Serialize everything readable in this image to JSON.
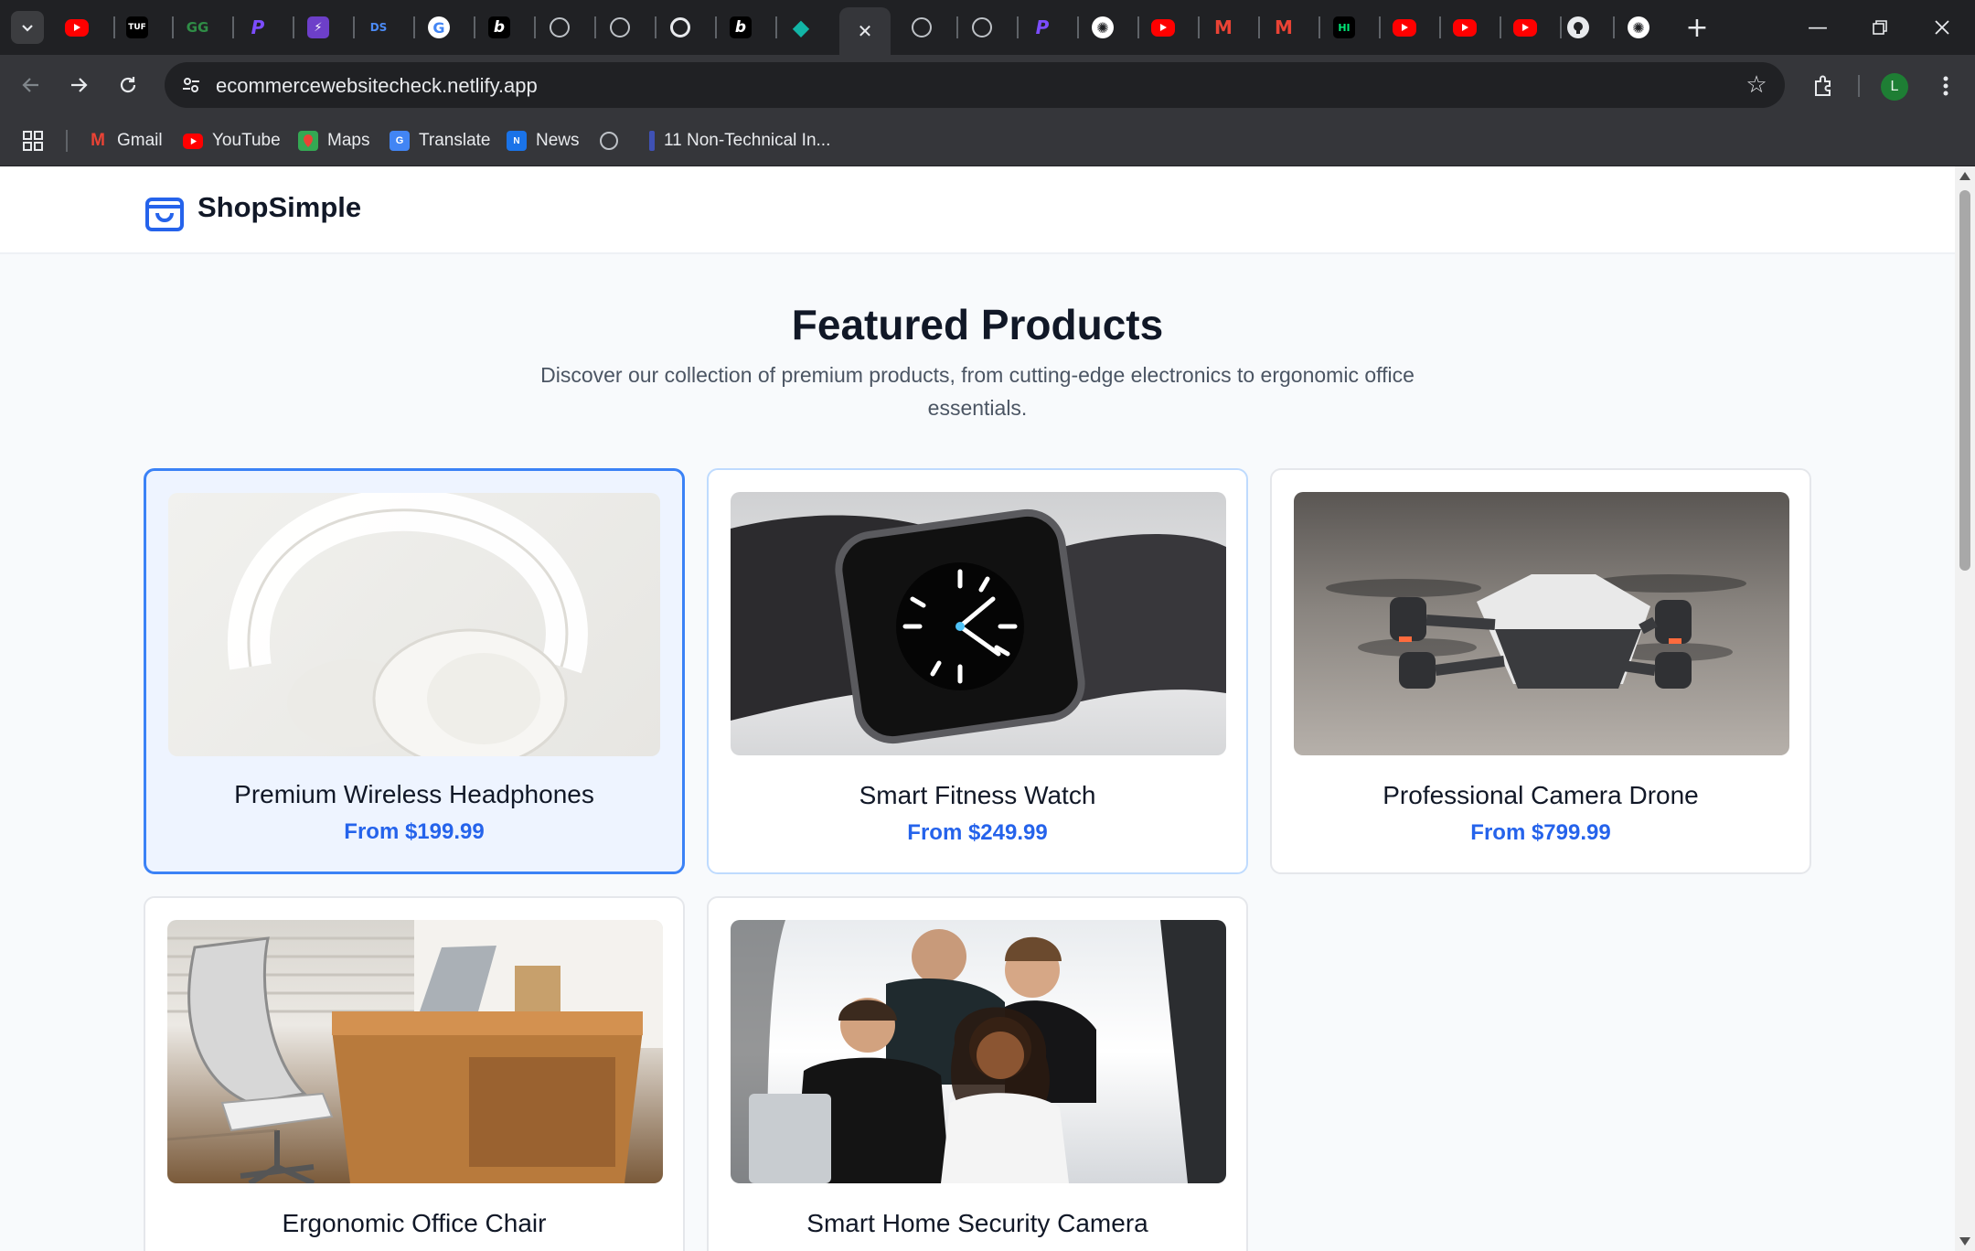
{
  "browser": {
    "url": "ecommercewebsitecheck.netlify.app",
    "profile_initial": "L",
    "tabs": [
      {
        "icon": "youtube-icon",
        "glyph": ""
      },
      {
        "icon": "tuf-icon",
        "glyph": "TUF"
      },
      {
        "icon": "geeksforgeeks-icon",
        "glyph": "GG"
      },
      {
        "icon": "p-logo-icon",
        "glyph": "P"
      },
      {
        "icon": "bolt-icon",
        "glyph": "⚡"
      },
      {
        "icon": "ds-icon",
        "glyph": "DS"
      },
      {
        "icon": "google-icon",
        "glyph": "G"
      },
      {
        "icon": "b-logo-icon",
        "glyph": "b"
      },
      {
        "icon": "globe-icon",
        "glyph": ""
      },
      {
        "icon": "globe-icon",
        "glyph": ""
      },
      {
        "icon": "chrome-icon",
        "glyph": ""
      },
      {
        "icon": "b-logo-icon",
        "glyph": "b"
      },
      {
        "icon": "diamond-icon",
        "glyph": "◆"
      },
      {
        "icon": "close-icon",
        "glyph": "✕"
      },
      {
        "icon": "globe-icon",
        "glyph": ""
      },
      {
        "icon": "globe-icon",
        "glyph": ""
      },
      {
        "icon": "p-logo-icon",
        "glyph": "P"
      },
      {
        "icon": "openai-icon",
        "glyph": "✺"
      },
      {
        "icon": "youtube-icon",
        "glyph": ""
      },
      {
        "icon": "gmail-icon",
        "glyph": "M"
      },
      {
        "icon": "gmail-icon",
        "glyph": "M"
      },
      {
        "icon": "hi-icon",
        "glyph": "HI"
      },
      {
        "icon": "youtube-icon",
        "glyph": ""
      },
      {
        "icon": "youtube-icon",
        "glyph": ""
      },
      {
        "icon": "youtube-icon",
        "glyph": ""
      },
      {
        "icon": "github-icon",
        "glyph": ""
      },
      {
        "icon": "openai-icon",
        "glyph": "✺"
      }
    ],
    "bookmarks": [
      {
        "label": "Gmail",
        "icon": "gmail-icon"
      },
      {
        "label": "YouTube",
        "icon": "youtube-icon"
      },
      {
        "label": "Maps",
        "icon": "maps-icon"
      },
      {
        "label": "Translate",
        "icon": "translate-icon"
      },
      {
        "label": "News",
        "icon": "news-icon"
      },
      {
        "label": "",
        "icon": "globe-icon"
      },
      {
        "label": "11 Non-Technical In...",
        "icon": "bookmark-page-icon"
      }
    ]
  },
  "site": {
    "brand": "ShopSimple",
    "hero_title": "Featured Products",
    "hero_subtitle": "Discover our collection of premium products, from cutting-edge electronics to ergonomic office essentials."
  },
  "products": [
    {
      "name": "Premium Wireless Headphones",
      "price": "From $199.99",
      "image": "headphones-photo"
    },
    {
      "name": "Smart Fitness Watch",
      "price": "From $249.99",
      "image": "smartwatch-photo"
    },
    {
      "name": "Professional Camera Drone",
      "price": "From $799.99",
      "image": "drone-photo"
    },
    {
      "name": "Ergonomic Office Chair",
      "price": "",
      "image": "office-chair-photo"
    },
    {
      "name": "Smart Home Security Camera",
      "price": "",
      "image": "team-photo"
    }
  ],
  "colors": {
    "accent": "#2563eb",
    "selected_border": "#3b82f6",
    "selected_bg": "#eef4ff"
  }
}
